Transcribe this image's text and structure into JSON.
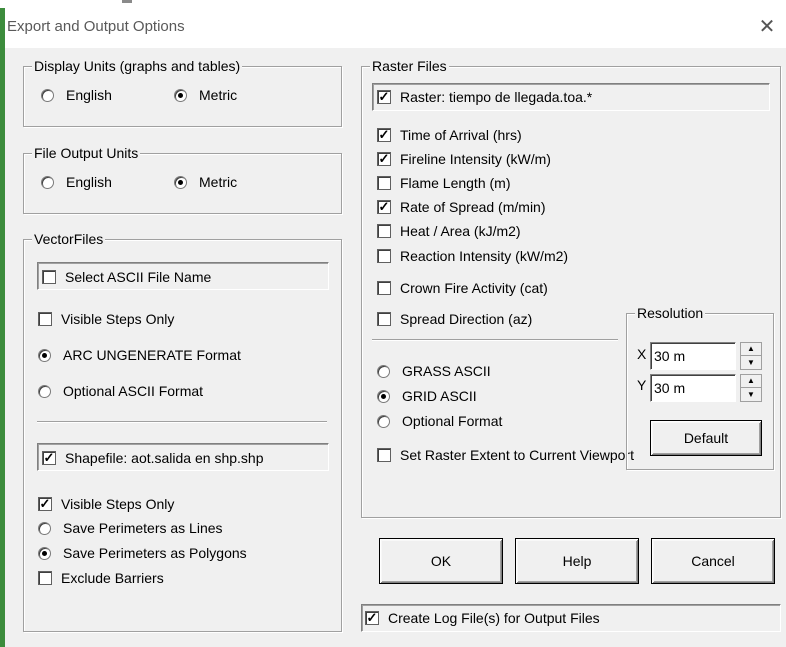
{
  "window": {
    "title": "Export and Output Options"
  },
  "display_units": {
    "legend": "Display Units (graphs and tables)",
    "english": "English",
    "metric": "Metric",
    "selected": "Metric"
  },
  "file_output_units": {
    "legend": "File Output Units",
    "english": "English",
    "metric": "Metric",
    "selected": "Metric"
  },
  "vector_files": {
    "legend": "VectorFiles",
    "select_ascii": {
      "label": "Select ASCII File Name",
      "checked": false
    },
    "visible_steps_only": {
      "label": "Visible Steps Only",
      "checked": false
    },
    "arc_ungenerate": {
      "label": "ARC UNGENERATE Format",
      "selected": true
    },
    "optional_ascii": {
      "label": "Optional ASCII Format",
      "selected": false
    },
    "shapefile": {
      "label": "Shapefile: aot.salida en shp.shp",
      "checked": true
    },
    "shp_visible_steps_only": {
      "label": "Visible Steps Only",
      "checked": true
    },
    "save_perimeters_lines": {
      "label": "Save Perimeters as Lines",
      "selected": false
    },
    "save_perimeters_polygons": {
      "label": "Save Perimeters as Polygons",
      "selected": true
    },
    "exclude_barriers": {
      "label": "Exclude Barriers",
      "checked": false
    }
  },
  "raster_files": {
    "legend": "Raster Files",
    "raster_file": {
      "label": "Raster: tiempo de llegada.toa.*",
      "checked": true
    },
    "outputs": [
      {
        "label": "Time of Arrival (hrs)",
        "checked": true
      },
      {
        "label": "Fireline Intensity (kW/m)",
        "checked": true
      },
      {
        "label": "Flame Length (m)",
        "checked": false
      },
      {
        "label": "Rate of Spread (m/min)",
        "checked": true
      },
      {
        "label": "Heat / Area (kJ/m2)",
        "checked": false
      },
      {
        "label": "Reaction Intensity (kW/m2)",
        "checked": false
      },
      {
        "label": "Crown Fire Activity (cat)",
        "checked": false
      },
      {
        "label": "Spread Direction (az)",
        "checked": false
      }
    ],
    "formats": [
      {
        "label": "GRASS ASCII",
        "selected": false
      },
      {
        "label": "GRID ASCII",
        "selected": true
      },
      {
        "label": "Optional Format",
        "selected": false
      }
    ],
    "set_extent": {
      "label": "Set Raster Extent to Current Viewport",
      "checked": false
    },
    "resolution": {
      "legend": "Resolution",
      "x_label": "X",
      "x_value": "30 m",
      "y_label": "Y",
      "y_value": "30 m",
      "default_label": "Default"
    }
  },
  "buttons": {
    "ok": "OK",
    "help": "Help",
    "cancel": "Cancel"
  },
  "log_file": {
    "label": "Create Log File(s) for Output Files",
    "checked": true
  },
  "icons": {
    "close": "close-icon",
    "check": "checkmark-icon",
    "spin_up": "spin-up-icon",
    "spin_down": "spin-down-icon"
  }
}
